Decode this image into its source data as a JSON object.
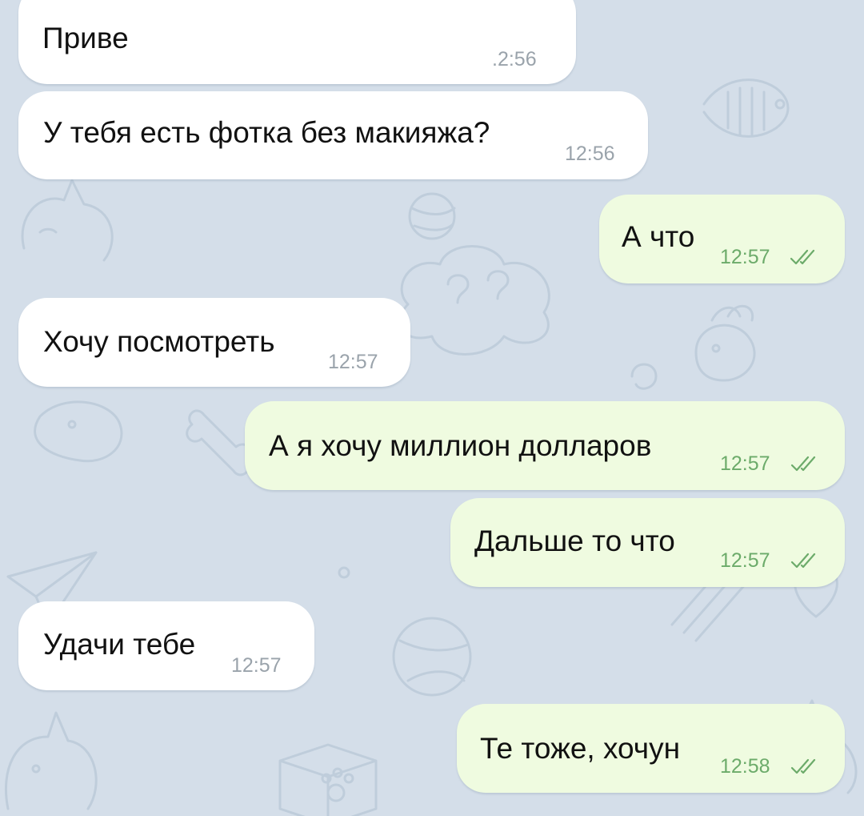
{
  "chat": {
    "messages": [
      {
        "id": "m1",
        "direction": "incoming",
        "text": "Приве",
        "time": "12:56",
        "time_visible": ".2:56"
      },
      {
        "id": "m2",
        "direction": "incoming",
        "text": "У тебя есть фотка без макияжа?",
        "time": "12:56"
      },
      {
        "id": "m3",
        "direction": "outgoing",
        "text": "А что",
        "time": "12:57",
        "status": "read"
      },
      {
        "id": "m4",
        "direction": "incoming",
        "text": "Хочу посмотреть",
        "time": "12:57"
      },
      {
        "id": "m5",
        "direction": "outgoing",
        "text": "А я хочу миллион долларов",
        "time": "12:57",
        "status": "read"
      },
      {
        "id": "m6",
        "direction": "outgoing",
        "text": "Дальше то что",
        "time": "12:57",
        "status": "read"
      },
      {
        "id": "m7",
        "direction": "incoming",
        "text": "Удачи тебе",
        "time": "12:57"
      },
      {
        "id": "m8",
        "direction": "outgoing",
        "text": "Те тоже, хочун",
        "time": "12:58",
        "status": "read"
      }
    ]
  },
  "colors": {
    "background": "#d4dee9",
    "incoming_bubble": "#ffffff",
    "outgoing_bubble": "#effbe0",
    "outgoing_time": "#6cab6a",
    "incoming_time": "#9aa3ab"
  },
  "icons": {
    "read_status": "double-check-icon",
    "background_pattern": "doodle-pattern"
  }
}
